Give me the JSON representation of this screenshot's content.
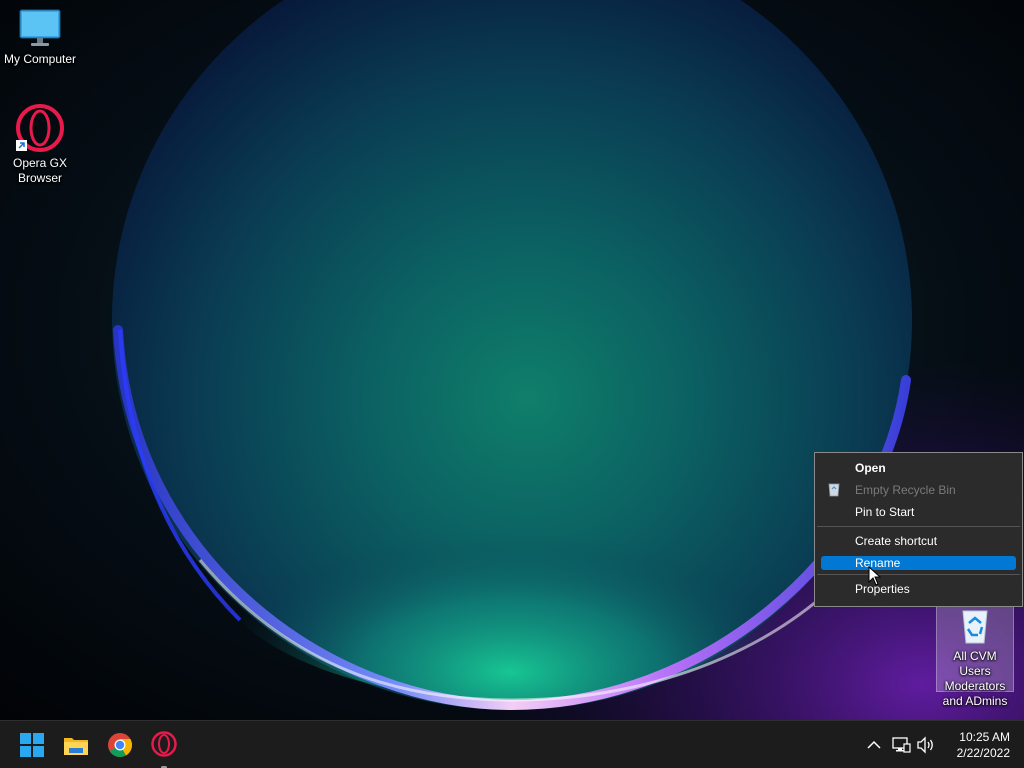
{
  "desktop": {
    "icons": [
      {
        "label": "My Computer",
        "icon": "monitor-icon"
      },
      {
        "label": "Opera GX Browser",
        "icon": "opera-gx-icon"
      },
      {
        "label": "All CVM Users Moderators and ADmins",
        "icon": "recycle-bin-icon"
      }
    ]
  },
  "context_menu": {
    "items": [
      {
        "label": "Open",
        "state": "default"
      },
      {
        "label": "Empty Recycle Bin",
        "state": "disabled",
        "icon": "recycle-bin-icon"
      },
      {
        "label": "Pin to Start",
        "state": "normal"
      },
      {
        "label": "Create shortcut",
        "state": "normal"
      },
      {
        "label": "Rename",
        "state": "highlighted"
      },
      {
        "label": "Properties",
        "state": "normal"
      }
    ]
  },
  "taskbar": {
    "buttons": [
      {
        "name": "start",
        "icon": "windows-logo-icon"
      },
      {
        "name": "file-explorer",
        "icon": "folder-icon"
      },
      {
        "name": "chrome",
        "icon": "chrome-icon"
      },
      {
        "name": "opera-gx",
        "icon": "opera-gx-icon",
        "running": true
      }
    ],
    "tray": {
      "icons": [
        "chevron-up-icon",
        "network-icon",
        "volume-icon"
      ],
      "time": "10:25 AM",
      "date": "2/22/2022"
    }
  },
  "colors": {
    "accent": "#0078d4",
    "menu_bg": "#2b2b2b",
    "taskbar_bg": "#1c1c1c",
    "opera_red": "#e8194b"
  }
}
